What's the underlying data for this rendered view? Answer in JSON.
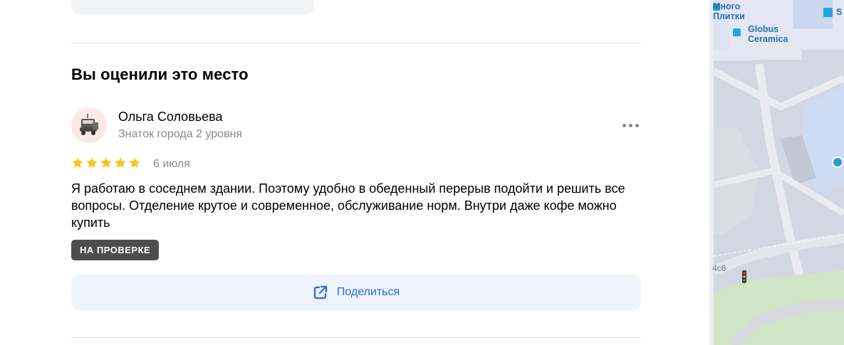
{
  "section": {
    "title": "Вы оценили это место"
  },
  "review": {
    "author_name": "Ольга Соловьева",
    "author_level": "Знаток города 2 уровня",
    "rating": 5,
    "rating_max": 5,
    "date": "6 июля",
    "text": "Я работаю в соседнем здании. Поэтому удобно в обеденный перерыв подойти и решить все вопросы. Отделение крутое и современное, обслуживание норм. Внутри даже кофе можно купить",
    "status_badge": "НА ПРОВЕРКЕ",
    "more_icon": "more-dots-icon",
    "star_color": "#fcc419"
  },
  "share": {
    "label": "Поделиться",
    "icon": "external-share-icon",
    "color": "#2c68d9"
  },
  "map": {
    "labels": {
      "shop1_line1": "Много",
      "shop1_line2": "Плитки",
      "shop2_line1": "Globus",
      "shop2_line2": "Ceramica",
      "shop3": "S",
      "house_number": "4с6"
    }
  }
}
